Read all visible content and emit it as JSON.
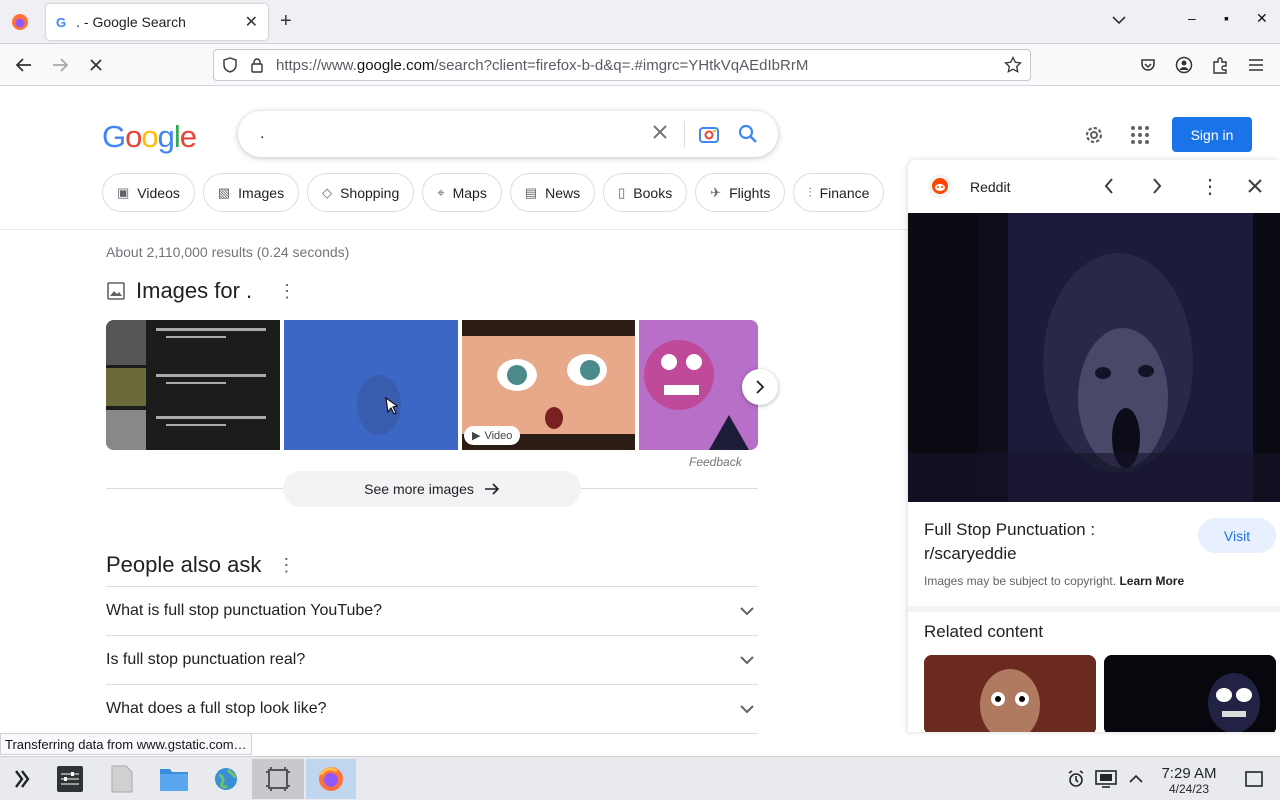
{
  "browser": {
    "tab_title": ". - Google Search",
    "tab_favicon_letter": "G",
    "url_prefix": "https://www.",
    "url_host": "google.com",
    "url_path": "/search?client=firefox-b-d&q=.#imgrc=YHtkVqAEdIbRrM"
  },
  "google": {
    "search_value": ".",
    "signin_label": "Sign in",
    "chips": [
      {
        "icon": "video-icon",
        "label": "Videos"
      },
      {
        "icon": "image-icon",
        "label": "Images"
      },
      {
        "icon": "tag-icon",
        "label": "Shopping"
      },
      {
        "icon": "map-pin-icon",
        "label": "Maps"
      },
      {
        "icon": "news-icon",
        "label": "News"
      },
      {
        "icon": "book-icon",
        "label": "Books"
      },
      {
        "icon": "plane-icon",
        "label": "Flights"
      },
      {
        "icon": "finance-icon",
        "label": "Finance"
      }
    ],
    "stats": "About 2,110,000 results (0.24 seconds)",
    "images_heading": "Images for .",
    "video_badge": "Video",
    "feedback": "Feedback",
    "see_more": "See more images",
    "paa_heading": "People also ask",
    "paa": [
      "What is full stop punctuation YouTube?",
      "Is full stop punctuation real?",
      "What does a full stop look like?"
    ]
  },
  "status_text": "Transferring data from www.gstatic.com…",
  "panel": {
    "source": "Reddit",
    "title": "Full Stop Punctuation : r/scaryeddie",
    "visit": "Visit",
    "copyright": "Images may be subject to copyright.",
    "learn_more": "Learn More",
    "related": "Related content"
  },
  "taskbar": {
    "time": "7:29 AM",
    "date": "4/24/23"
  },
  "colors": {
    "accent": "#1a73e8",
    "reddit": "#ff4500"
  }
}
